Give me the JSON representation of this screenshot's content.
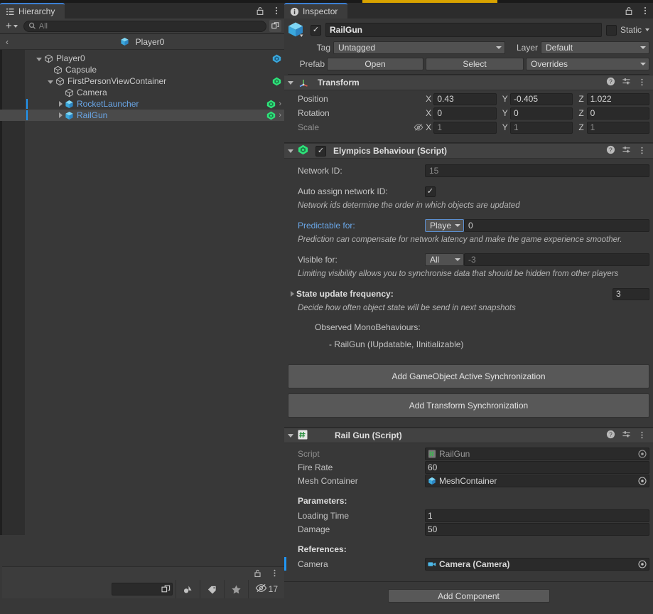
{
  "window": {
    "accent_blue": "#3c7fd4",
    "top_bar_color": "#d8a300",
    "prefab_blue": "#2196f3"
  },
  "hierarchy": {
    "tab_label": "Hierarchy",
    "toolbar": {
      "add_label": "+",
      "search_placeholder": "All",
      "search_value": ""
    },
    "breadcrumb": {
      "back": "‹",
      "label": "Player0"
    },
    "tree": [
      {
        "name": "Player0",
        "indent": 1,
        "expanded": true,
        "arrow": "open",
        "prefab": false,
        "selected": false,
        "gear": "blue",
        "chevron": false,
        "prefab_bar": false
      },
      {
        "name": "Capsule",
        "indent": 2,
        "expanded": false,
        "arrow": "none",
        "prefab": false,
        "selected": false,
        "gear": "none",
        "chevron": false,
        "prefab_bar": false
      },
      {
        "name": "FirstPersonViewContainer",
        "indent": 2,
        "expanded": true,
        "arrow": "open",
        "prefab": false,
        "selected": false,
        "gear": "green",
        "chevron": false,
        "prefab_bar": false
      },
      {
        "name": "Camera",
        "indent": 3,
        "expanded": false,
        "arrow": "none",
        "prefab": false,
        "selected": false,
        "gear": "none",
        "chevron": false,
        "prefab_bar": false
      },
      {
        "name": "RocketLauncher",
        "indent": 3,
        "expanded": false,
        "arrow": "closed",
        "prefab": true,
        "selected": false,
        "gear": "green",
        "chevron": true,
        "prefab_bar": true
      },
      {
        "name": "RailGun",
        "indent": 3,
        "expanded": false,
        "arrow": "closed",
        "prefab": true,
        "selected": true,
        "gear": "green",
        "chevron": true,
        "prefab_bar": true
      }
    ],
    "footer": {
      "hidden_count": "17"
    }
  },
  "inspector": {
    "tab_label": "Inspector",
    "object": {
      "enabled": true,
      "name": "RailGun",
      "static_label": "Static",
      "static_checked": false,
      "tag_label": "Tag",
      "tag_value": "Untagged",
      "layer_label": "Layer",
      "layer_value": "Default",
      "prefab_label": "Prefab",
      "open_label": "Open",
      "select_label": "Select",
      "overrides_label": "Overrides"
    },
    "transform": {
      "title": "Transform",
      "rows": [
        {
          "label": "Position",
          "dim": false,
          "values": [
            "0.43",
            "-0.405",
            "1.022"
          ],
          "dim_values": false,
          "eye": false
        },
        {
          "label": "Rotation",
          "dim": false,
          "values": [
            "0",
            "0",
            "0"
          ],
          "dim_values": false,
          "eye": false
        },
        {
          "label": "Scale",
          "dim": true,
          "values": [
            "1",
            "1",
            "1"
          ],
          "dim_values": true,
          "eye": true
        }
      ],
      "axes": [
        "X",
        "Y",
        "Z"
      ]
    },
    "elympics": {
      "title": "Elympics Behaviour (Script)",
      "enabled": true,
      "network_id_label": "Network ID:",
      "network_id_value": "15",
      "auto_assign_label": "Auto assign network ID:",
      "auto_assign_checked": true,
      "auto_assign_hint": "Network ids determine the order in which objects are updated",
      "predictable_label": "Predictable for:",
      "predictable_value": "Playe",
      "predictable_number": "0",
      "predictable_hint": "Prediction can compensate for network latency and make the game experience smoother.",
      "visible_label": "Visible for:",
      "visible_value": "All",
      "visible_number": "-3",
      "visible_hint": "Limiting visibility allows you to synchronise data that should be hidden from other players",
      "state_freq_label": "State update frequency:",
      "state_freq_value": "3",
      "state_freq_hint": "Decide how often object state will be send in next snapshots",
      "observed_label": "Observed MonoBehaviours:",
      "observed_items": [
        "- RailGun (IUpdatable, IInitializable)"
      ],
      "btn_gameobject_sync": "Add GameObject Active Synchronization",
      "btn_transform_sync": "Add Transform Synchronization"
    },
    "railgun": {
      "title": "Rail Gun (Script)",
      "script_label": "Script",
      "script_value": "RailGun",
      "fire_rate_label": "Fire Rate",
      "fire_rate_value": "60",
      "mesh_container_label": "Mesh Container",
      "mesh_container_value": "MeshContainer",
      "parameters_label": "Parameters:",
      "loading_time_label": "Loading Time",
      "loading_time_value": "1",
      "damage_label": "Damage",
      "damage_value": "50",
      "references_label": "References:",
      "camera_label": "Camera",
      "camera_value": "Camera (Camera)"
    },
    "add_component_label": "Add Component"
  }
}
